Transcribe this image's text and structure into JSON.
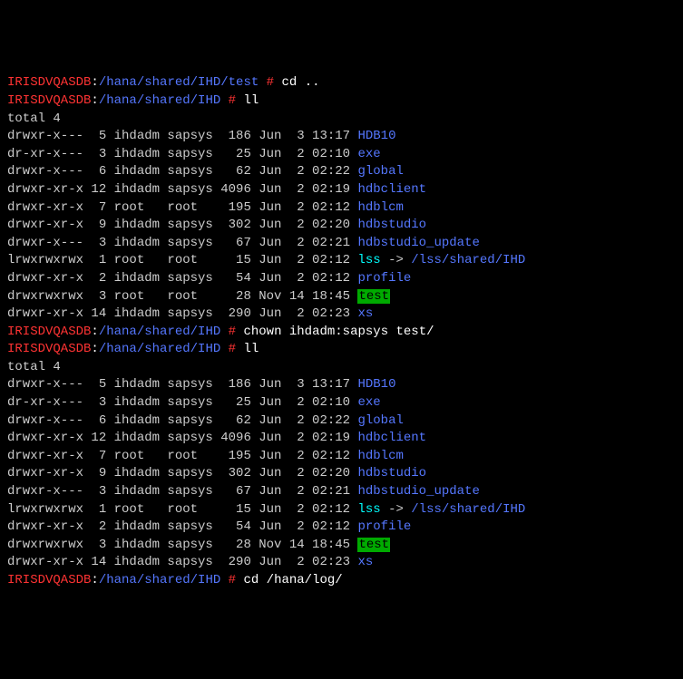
{
  "prompts": {
    "p0": {
      "host": "IRISDVQASDB",
      "path": "/hana/shared/IHD/test",
      "cmd": "cd .."
    },
    "p1": {
      "host": "IRISDVQASDB",
      "path": "/hana/shared/IHD",
      "cmd": "ll"
    },
    "p2": {
      "host": "IRISDVQASDB",
      "path": "/hana/shared/IHD",
      "cmd": "chown ihdadm:sapsys test/"
    },
    "p3": {
      "host": "IRISDVQASDB",
      "path": "/hana/shared/IHD",
      "cmd": "ll"
    },
    "p4": {
      "host": "IRISDVQASDB",
      "path": "/hana/shared/IHD",
      "cmd": "cd /hana/log/"
    }
  },
  "totals": {
    "t1": "total 4",
    "t2": "total 4"
  },
  "listing1": {
    "r0": {
      "prefix": "drwxr-x---  5 ihdadm sapsys  186 Jun  3 13:17 ",
      "name": "HDB10",
      "type": "dir"
    },
    "r1": {
      "prefix": "dr-xr-x---  3 ihdadm sapsys   25 Jun  2 02:10 ",
      "name": "exe",
      "type": "dir"
    },
    "r2": {
      "prefix": "drwxr-x---  6 ihdadm sapsys   62 Jun  2 02:22 ",
      "name": "global",
      "type": "dir"
    },
    "r3": {
      "prefix": "drwxr-xr-x 12 ihdadm sapsys 4096 Jun  2 02:19 ",
      "name": "hdbclient",
      "type": "dir"
    },
    "r4": {
      "prefix": "drwxr-xr-x  7 root   root    195 Jun  2 02:12 ",
      "name": "hdblcm",
      "type": "dir"
    },
    "r5": {
      "prefix": "drwxr-xr-x  9 ihdadm sapsys  302 Jun  2 02:20 ",
      "name": "hdbstudio",
      "type": "dir"
    },
    "r6": {
      "prefix": "drwxr-x---  3 ihdadm sapsys   67 Jun  2 02:21 ",
      "name": "hdbstudio_update",
      "type": "dir"
    },
    "r7": {
      "prefix": "lrwxrwxrwx  1 root   root     15 Jun  2 02:12 ",
      "name": "lss",
      "arrow": " -> ",
      "target": "/lss/shared/IHD",
      "type": "link"
    },
    "r8": {
      "prefix": "drwxr-xr-x  2 ihdadm sapsys   54 Jun  2 02:12 ",
      "name": "profile",
      "type": "dir"
    },
    "r9": {
      "prefix": "drwxrwxrwx  3 root   root     28 Nov 14 18:45 ",
      "name": "test",
      "type": "hl"
    },
    "r10": {
      "prefix": "drwxr-xr-x 14 ihdadm sapsys  290 Jun  2 02:23 ",
      "name": "xs",
      "type": "dir"
    }
  },
  "listing2": {
    "r0": {
      "prefix": "drwxr-x---  5 ihdadm sapsys  186 Jun  3 13:17 ",
      "name": "HDB10",
      "type": "dir"
    },
    "r1": {
      "prefix": "dr-xr-x---  3 ihdadm sapsys   25 Jun  2 02:10 ",
      "name": "exe",
      "type": "dir"
    },
    "r2": {
      "prefix": "drwxr-x---  6 ihdadm sapsys   62 Jun  2 02:22 ",
      "name": "global",
      "type": "dir"
    },
    "r3": {
      "prefix": "drwxr-xr-x 12 ihdadm sapsys 4096 Jun  2 02:19 ",
      "name": "hdbclient",
      "type": "dir"
    },
    "r4": {
      "prefix": "drwxr-xr-x  7 root   root    195 Jun  2 02:12 ",
      "name": "hdblcm",
      "type": "dir"
    },
    "r5": {
      "prefix": "drwxr-xr-x  9 ihdadm sapsys  302 Jun  2 02:20 ",
      "name": "hdbstudio",
      "type": "dir"
    },
    "r6": {
      "prefix": "drwxr-x---  3 ihdadm sapsys   67 Jun  2 02:21 ",
      "name": "hdbstudio_update",
      "type": "dir"
    },
    "r7": {
      "prefix": "lrwxrwxrwx  1 root   root     15 Jun  2 02:12 ",
      "name": "lss",
      "arrow": " -> ",
      "target": "/lss/shared/IHD",
      "type": "link"
    },
    "r8": {
      "prefix": "drwxr-xr-x  2 ihdadm sapsys   54 Jun  2 02:12 ",
      "name": "profile",
      "type": "dir"
    },
    "r9": {
      "prefix": "drwxrwxrwx  3 ihdadm sapsys   28 Nov 14 18:45 ",
      "name": "test",
      "type": "hl"
    },
    "r10": {
      "prefix": "drwxr-xr-x 14 ihdadm sapsys  290 Jun  2 02:23 ",
      "name": "xs",
      "type": "dir"
    }
  }
}
